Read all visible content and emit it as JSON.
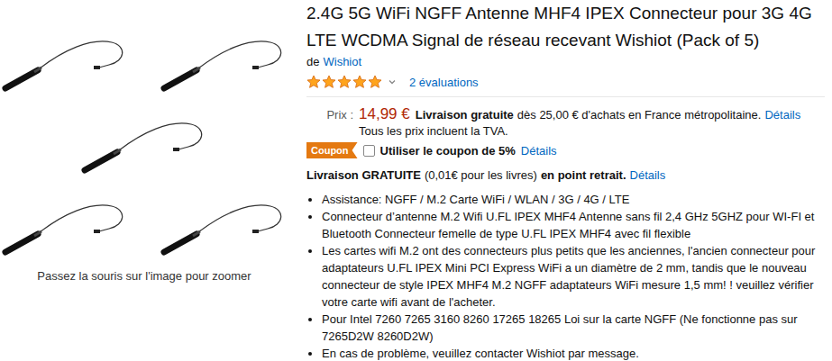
{
  "gallery": {
    "caption": "Passez la souris sur l'image pour zoomer"
  },
  "product": {
    "title": "2.4G 5G WiFi NGFF Antenne MHF4 IPEX Connecteur pour 3G 4G LTE WCDMA Signal de réseau recevant Wishiot (Pack of 5)",
    "brand_prefix": "de",
    "brand": "Wishiot",
    "stars": 5,
    "ratings_count": "2 évaluations"
  },
  "price": {
    "label": "Prix :",
    "amount": "14,99 €",
    "shipping_bold": "Livraison gratuite",
    "shipping_text": "dès 25,00 € d'achats en France métropolitaine.",
    "details": "Détails",
    "vat": "Tous les prix incluent la TVA."
  },
  "coupon": {
    "badge": "Coupon",
    "checked": false,
    "label": "Utiliser le coupon de 5%",
    "details": "Détails"
  },
  "pickup": {
    "bold": "Livraison GRATUITE",
    "text": "(0,01€ pour les livres)",
    "bold2": "en point retrait.",
    "details": "Détails"
  },
  "bullets": [
    "Assistance: NGFF / M.2 Carte WiFi / WLAN / 3G / 4G / LTE",
    "Connecteur d’antenne M.2 Wifi U.FL IPEX MHF4 Antenne sans fil 2,4 GHz 5GHZ pour WI-FI et Bluetooth Connecteur femelle de type U.FL IPEX MHF4 avec fil flexible",
    "Les cartes wifi M.2 ont des connecteurs plus petits que les anciennes, l'ancien connecteur pour adaptateurs U.FL IPEX Mini PCI Express WiFi a un diamètre de 2 mm, tandis que le nouveau connecteur de style IPEX MHF4 M.2 NGFF adaptateurs WiFi mesure 1,5 mm! ! veuillez vérifier votre carte wifi avant de l'acheter.",
    "Pour Intel 7260 7265 3160 8260 17265 18265 Loi sur la carte NGFF (Ne fonctionne pas sur 7265D2W 8260D2W)",
    "En cas de problème, veuillez contacter Wishiot par message."
  ]
}
